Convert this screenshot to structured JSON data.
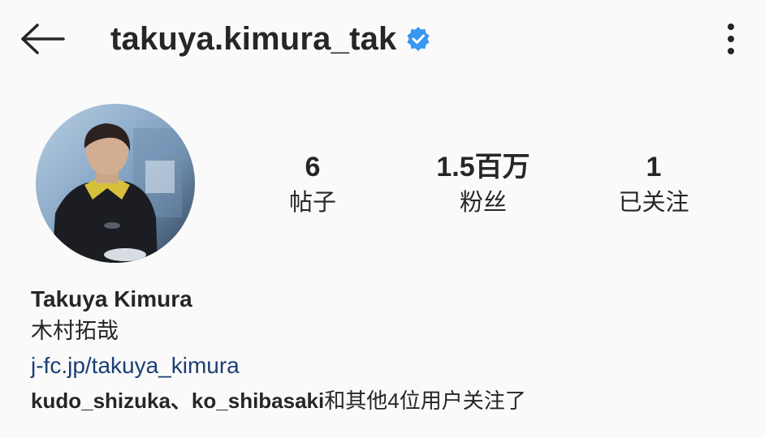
{
  "header": {
    "username": "takuya.kimura_tak",
    "verified_icon": "verified-badge-icon",
    "back_icon": "back-arrow-icon",
    "more_icon": "more-vertical-icon",
    "accent_color": "#3897f0"
  },
  "profile": {
    "avatar_icon": "profile-photo",
    "stats": [
      {
        "value": "6",
        "label": "帖子"
      },
      {
        "value": "1.5百万",
        "label": "粉丝"
      },
      {
        "value": "1",
        "label": "已关注"
      }
    ]
  },
  "bio": {
    "full_name": "Takuya Kimura",
    "native_name": "木村拓哉",
    "link": "j-fc.jp/takuya_kimura",
    "link_color": "#1c3f75",
    "followed_by_users": "kudo_shizuka、ko_shibasaki",
    "followed_by_suffix": "和其他4位用户关注了"
  }
}
